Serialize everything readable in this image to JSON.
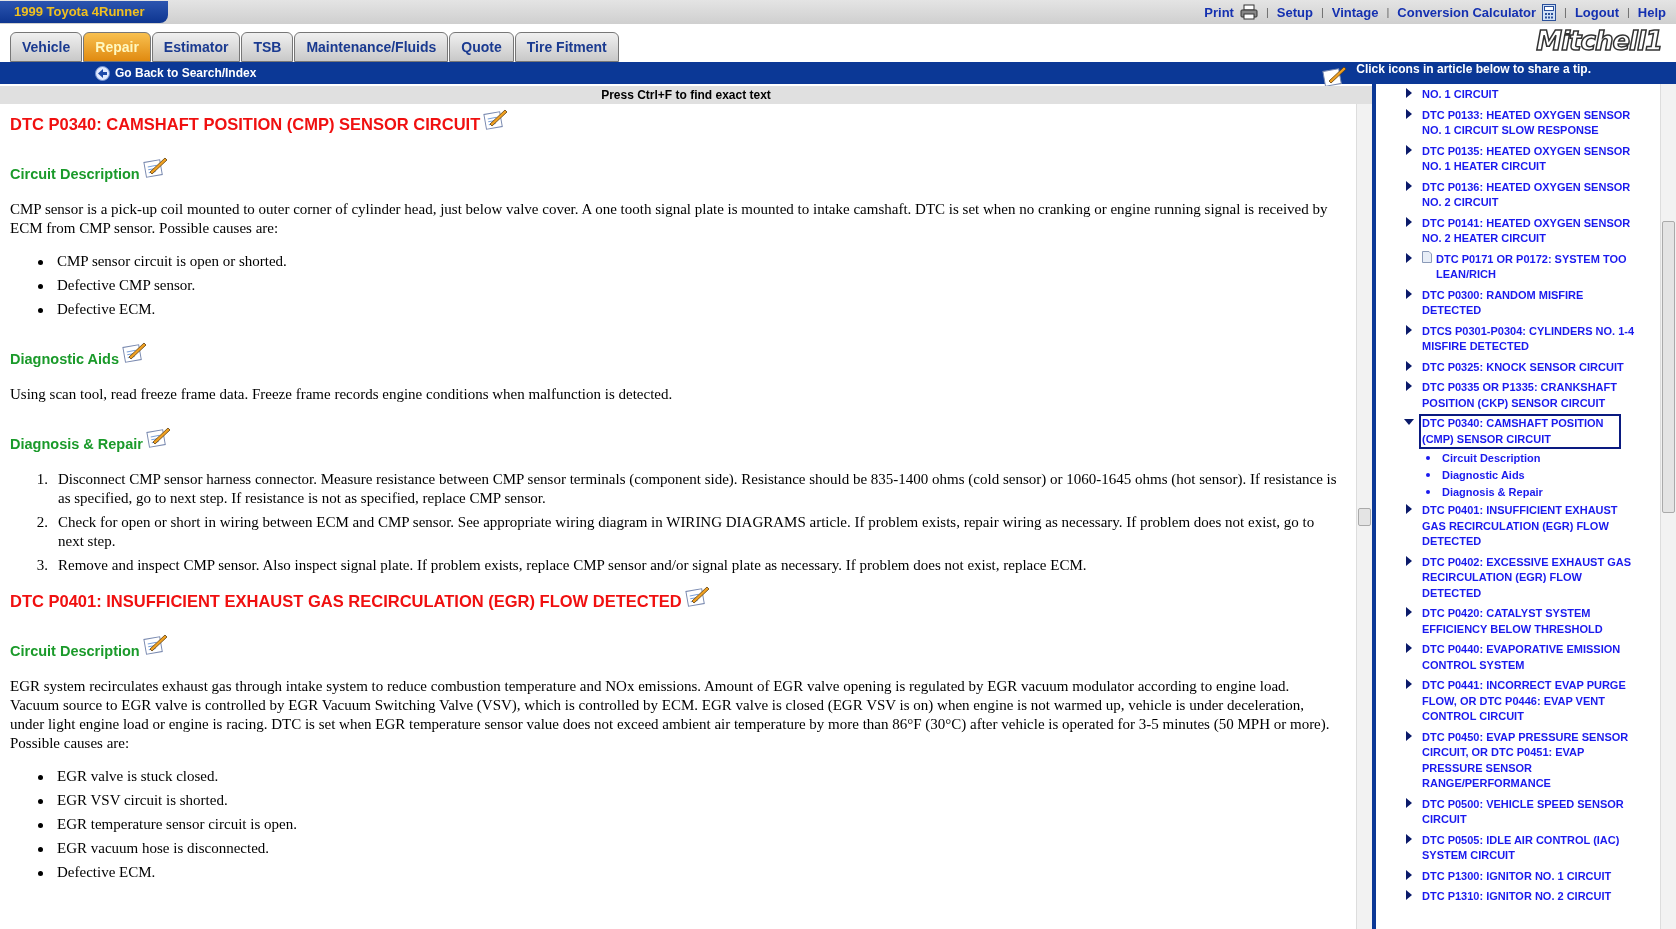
{
  "header": {
    "vehicle": "1999 Toyota 4Runner",
    "links": [
      {
        "label": "Print",
        "kind": "printer"
      },
      {
        "label": "Setup",
        "kind": "plain",
        "separator": "|"
      },
      {
        "label": "Vintage",
        "kind": "plain",
        "separator": "|"
      },
      {
        "label": "Conversion Calculator",
        "kind": "calculator",
        "separator": "|"
      },
      {
        "label": "Logout",
        "kind": "plain",
        "separator": "|"
      },
      {
        "label": "Help",
        "kind": "plain",
        "separator": "|"
      }
    ],
    "logo": "Mitchell1"
  },
  "tabs": [
    {
      "label": "Vehicle",
      "selected": false
    },
    {
      "label": "Repair",
      "selected": true
    },
    {
      "label": "Estimator",
      "selected": false
    },
    {
      "label": "TSB",
      "selected": false
    },
    {
      "label": "Maintenance/Fluids",
      "selected": false
    },
    {
      "label": "Quote",
      "selected": false
    },
    {
      "label": "Tire Fitment",
      "selected": false
    }
  ],
  "nav_bar": {
    "back_link": "Go Back to Search/Index",
    "tip": "Click icons in article below to share a tip."
  },
  "find_hint": "Press Ctrl+F to find exact text",
  "article": [
    {
      "kind": "title",
      "text": "DTC P0340: CAMSHAFT POSITION (CMP) SENSOR CIRCUIT"
    },
    {
      "kind": "heading",
      "text": "Circuit Description"
    },
    {
      "kind": "paragraph",
      "text": "CMP sensor is a pick-up coil mounted to outer corner of cylinder head, just below valve cover. A one tooth signal plate is mounted to intake camshaft. DTC is set when no cranking or engine running signal is received by ECM from CMP sensor. Possible causes are:"
    },
    {
      "kind": "bullets",
      "items": [
        "CMP sensor circuit is open or shorted.",
        "Defective CMP sensor.",
        "Defective ECM."
      ]
    },
    {
      "kind": "heading",
      "text": "Diagnostic Aids"
    },
    {
      "kind": "paragraph",
      "text": "Using scan tool, read freeze frame data. Freeze frame records engine conditions when malfunction is detected."
    },
    {
      "kind": "heading",
      "text": "Diagnosis & Repair"
    },
    {
      "kind": "numbered",
      "items": [
        {
          "number": "1.",
          "text": "Disconnect CMP sensor harness connector. Measure resistance between CMP sensor terminals (component side). Resistance should be 835-1400 ohms (cold sensor) or 1060-1645 ohms (hot sensor). If resistance is as specified, go to next step. If resistance is not as specified, replace CMP sensor."
        },
        {
          "number": "2.",
          "text": "Check for open or short in wiring between ECM and CMP sensor. See appropriate wiring diagram in WIRING DIAGRAMS article. If problem exists, repair wiring as necessary. If problem does not exist, go to next step."
        },
        {
          "number": "3.",
          "text": "Remove and inspect CMP sensor. Also inspect signal plate. If problem exists, replace CMP sensor and/or signal plate as necessary. If problem does not exist, replace ECM."
        }
      ]
    },
    {
      "kind": "title",
      "text": "DTC P0401: INSUFFICIENT EXHAUST GAS RECIRCULATION (EGR) FLOW DETECTED"
    },
    {
      "kind": "heading",
      "text": "Circuit Description"
    },
    {
      "kind": "paragraph",
      "text": "EGR system recirculates exhaust gas through intake system to reduce combustion temperature and NOx emissions. Amount of EGR valve opening is regulated by EGR vacuum modulator according to engine load. Vacuum source to EGR valve is controlled by EGR Vacuum Switching Valve (VSV), which is controlled by ECM. EGR valve is closed (EGR VSV is on) when engine is not warmed up, vehicle is under deceleration, under light engine load or engine is racing. DTC is set when EGR temperature sensor value does not exceed ambient air temperature by more than 86°F (30°C) after vehicle is operated for 3-5 minutes (50 MPH or more). Possible causes are:"
    },
    {
      "kind": "bullets",
      "items": [
        "EGR valve is stuck closed.",
        "EGR VSV circuit is shorted.",
        "EGR temperature sensor circuit is open.",
        "EGR vacuum hose is disconnected.",
        "Defective ECM."
      ]
    }
  ],
  "sidebar": [
    {
      "kind": "topic",
      "text": "NO. 1 CIRCUIT",
      "expanded": false,
      "selected": false
    },
    {
      "kind": "topic",
      "text": "DTC P0133: HEATED OXYGEN SENSOR NO. 1 CIRCUIT SLOW RESPONSE",
      "expanded": false,
      "selected": false
    },
    {
      "kind": "topic",
      "text": "DTC P0135: HEATED OXYGEN SENSOR NO. 1 HEATER CIRCUIT",
      "expanded": false,
      "selected": false
    },
    {
      "kind": "topic",
      "text": "DTC P0136: HEATED OXYGEN SENSOR NO. 2 CIRCUIT",
      "expanded": false,
      "selected": false
    },
    {
      "kind": "topic",
      "text": "DTC P0141: HEATED OXYGEN SENSOR NO. 2 HEATER CIRCUIT",
      "expanded": false,
      "selected": false
    },
    {
      "kind": "document",
      "text": "DTC P0171 OR P0172: SYSTEM TOO LEAN/RICH",
      "expanded": false,
      "selected": false
    },
    {
      "kind": "topic",
      "text": "DTC P0300: RANDOM MISFIRE DETECTED",
      "expanded": false,
      "selected": false
    },
    {
      "kind": "topic",
      "text": "DTCS P0301-P0304: CYLINDERS NO. 1-4 MISFIRE DETECTED",
      "expanded": false,
      "selected": false
    },
    {
      "kind": "topic",
      "text": "DTC P0325: KNOCK SENSOR CIRCUIT",
      "expanded": false,
      "selected": false
    },
    {
      "kind": "topic",
      "text": "DTC P0335 OR P1335: CRANKSHAFT POSITION (CKP) SENSOR CIRCUIT",
      "expanded": false,
      "selected": false
    },
    {
      "kind": "topic",
      "text": "DTC P0340: CAMSHAFT POSITION (CMP) SENSOR CIRCUIT",
      "expanded": true,
      "selected": true,
      "children": [
        "Circuit Description",
        "Diagnostic Aids",
        "Diagnosis & Repair"
      ]
    },
    {
      "kind": "topic",
      "text": "DTC P0401: INSUFFICIENT EXHAUST GAS RECIRCULATION (EGR) FLOW DETECTED",
      "expanded": false,
      "selected": false
    },
    {
      "kind": "topic",
      "text": "DTC P0402: EXCESSIVE EXHAUST GAS RECIRCULATION (EGR) FLOW DETECTED",
      "expanded": false,
      "selected": false
    },
    {
      "kind": "topic",
      "text": "DTC P0420: CATALYST SYSTEM EFFICIENCY BELOW THRESHOLD",
      "expanded": false,
      "selected": false
    },
    {
      "kind": "topic",
      "text": "DTC P0440: EVAPORATIVE EMISSION CONTROL SYSTEM",
      "expanded": false,
      "selected": false
    },
    {
      "kind": "topic",
      "text": "DTC P0441: INCORRECT EVAP PURGE FLOW, OR DTC P0446: EVAP VENT CONTROL CIRCUIT",
      "expanded": false,
      "selected": false
    },
    {
      "kind": "topic",
      "text": "DTC P0450: EVAP PRESSURE SENSOR CIRCUIT, OR DTC P0451: EVAP PRESSURE SENSOR RANGE/PERFORMANCE",
      "expanded": false,
      "selected": false
    },
    {
      "kind": "topic",
      "text": "DTC P0500: VEHICLE SPEED SENSOR CIRCUIT",
      "expanded": false,
      "selected": false
    },
    {
      "kind": "topic",
      "text": "DTC P0505: IDLE AIR CONTROL (IAC) SYSTEM CIRCUIT",
      "expanded": false,
      "selected": false
    },
    {
      "kind": "topic",
      "text": "DTC P1300: IGNITOR NO. 1 CIRCUIT",
      "expanded": false,
      "selected": false
    },
    {
      "kind": "topic",
      "text": "DTC P1310: IGNITOR NO. 2 CIRCUIT",
      "expanded": false,
      "selected": false
    }
  ]
}
